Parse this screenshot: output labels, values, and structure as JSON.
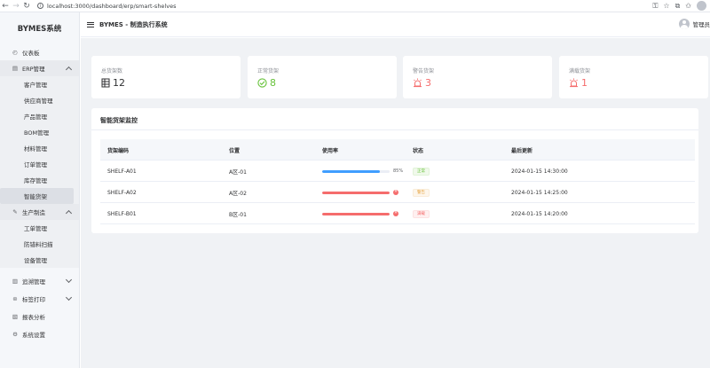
{
  "browser": {
    "url": "localhost:3000/dashboard/erp/smart-shelves"
  },
  "sidebar": {
    "logo": "BYMES系统",
    "items": [
      {
        "label": "仪表板",
        "icon": "dashboard-icon"
      },
      {
        "label": "ERP管理",
        "icon": "erp-icon",
        "expanded": true,
        "children": [
          "客户管理",
          "供应商管理",
          "产品管理",
          "BOM管理",
          "材料管理",
          "订单管理",
          "库存管理",
          "智能货架"
        ]
      },
      {
        "label": "生产制造",
        "icon": "wrench-icon",
        "expanded": true,
        "children": [
          "工单管理",
          "防错料扫描",
          "设备管理"
        ]
      },
      {
        "label": "追溯管理",
        "icon": "trace-icon",
        "expanded": false
      },
      {
        "label": "标签打印",
        "icon": "print-icon",
        "expanded": false
      },
      {
        "label": "报表分析",
        "icon": "report-icon"
      },
      {
        "label": "系统设置",
        "icon": "gear-icon"
      }
    ],
    "active_item": "智能货架"
  },
  "header": {
    "title": "BYMES - 制造执行系统",
    "user": "管理员"
  },
  "stats": [
    {
      "label": "总货架数",
      "value": "12",
      "icon": "grid-icon",
      "color": "#303133"
    },
    {
      "label": "正常货架",
      "value": "8",
      "icon": "check-circle-icon",
      "color": "#67c23a"
    },
    {
      "label": "警告货架",
      "value": "3",
      "icon": "alarm-icon",
      "color": "#f56c6c"
    },
    {
      "label": "满载货架",
      "value": "1",
      "icon": "alarm-icon",
      "color": "#f56c6c"
    }
  ],
  "monitor": {
    "title": "智能货架监控",
    "columns": [
      "货架编码",
      "位置",
      "使用率",
      "状态",
      "最后更新"
    ],
    "rows": [
      {
        "code": "SHELF-A01",
        "location": "A区-01",
        "usage": 85,
        "usage_text": "85%",
        "bar_color": "#409eff",
        "status": "正常",
        "status_type": "ok",
        "updated": "2024-01-15 14:30:00"
      },
      {
        "code": "SHELF-A02",
        "location": "A区-02",
        "usage": 100,
        "usage_text": "",
        "bar_color": "#f56c6c",
        "status": "警告",
        "status_type": "warn",
        "updated": "2024-01-15 14:25:00"
      },
      {
        "code": "SHELF-B01",
        "location": "B区-01",
        "usage": 100,
        "usage_text": "",
        "bar_color": "#f56c6c",
        "status": "满载",
        "status_type": "full",
        "updated": "2024-01-15 14:20:00"
      }
    ]
  }
}
